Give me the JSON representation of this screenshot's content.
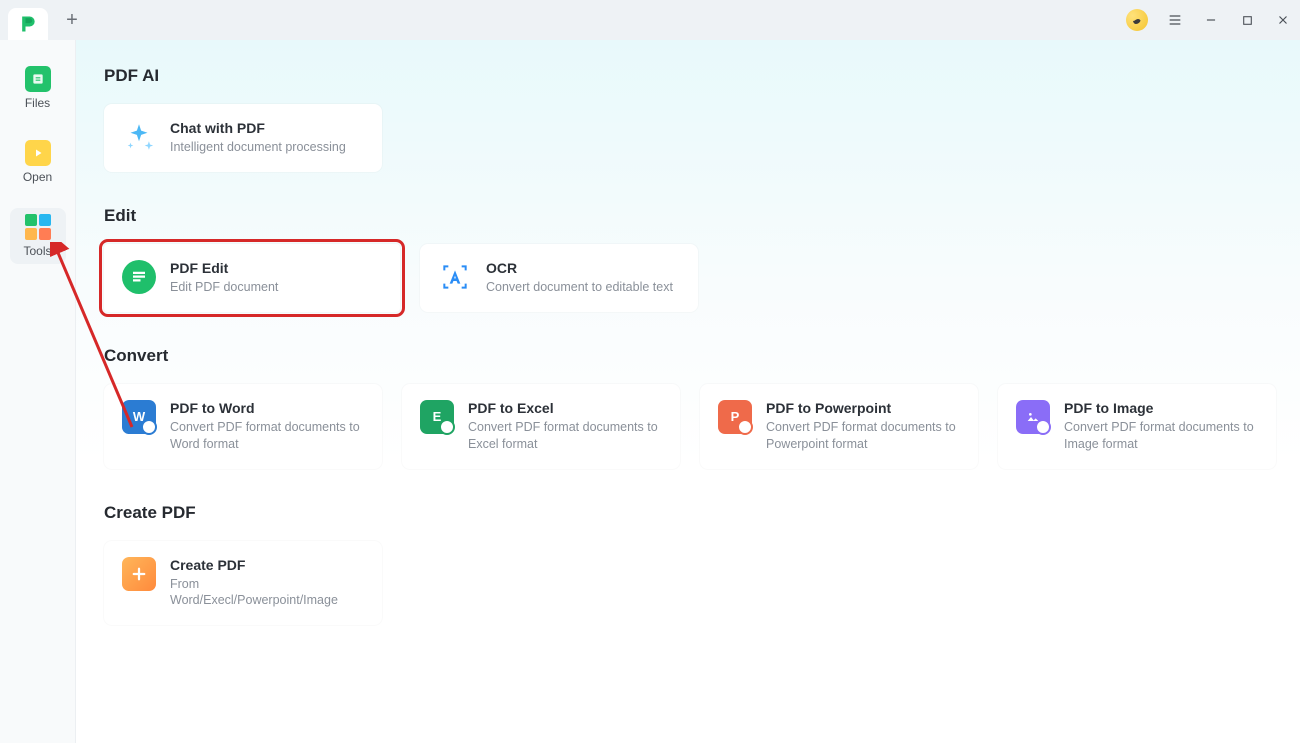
{
  "titlebar": {
    "new_tab_tooltip": "+"
  },
  "sidebar": {
    "items": [
      {
        "id": "files",
        "label": "Files"
      },
      {
        "id": "open",
        "label": "Open"
      },
      {
        "id": "tools",
        "label": "Tools"
      }
    ],
    "active": "tools"
  },
  "sections": {
    "pdf_ai": {
      "heading": "PDF AI",
      "cards": [
        {
          "id": "chat-with-pdf",
          "title": "Chat with PDF",
          "sub": "Intelligent document processing"
        }
      ]
    },
    "edit": {
      "heading": "Edit",
      "cards": [
        {
          "id": "pdf-edit",
          "title": "PDF Edit",
          "sub": "Edit PDF document",
          "highlighted": true
        },
        {
          "id": "ocr",
          "title": "OCR",
          "sub": "Convert document to editable text"
        }
      ]
    },
    "convert": {
      "heading": "Convert",
      "cards": [
        {
          "id": "pdf-to-word",
          "title": "PDF to Word",
          "sub": "Convert PDF format documents to Word format"
        },
        {
          "id": "pdf-to-excel",
          "title": "PDF to Excel",
          "sub": "Convert PDF format documents to Excel format"
        },
        {
          "id": "pdf-to-powerpoint",
          "title": "PDF to Powerpoint",
          "sub": "Convert PDF format documents to Powerpoint format"
        },
        {
          "id": "pdf-to-image",
          "title": "PDF to Image",
          "sub": "Convert PDF format documents to Image format"
        }
      ]
    },
    "create_pdf": {
      "heading": "Create PDF",
      "cards": [
        {
          "id": "create-pdf",
          "title": "Create PDF",
          "sub": "From Word/Execl/Powerpoint/Image"
        }
      ]
    }
  },
  "annotation": {
    "pdf_edit_highlighted": true,
    "arrow_from": "pdf-edit-card",
    "arrow_to": "sidebar-tools"
  }
}
